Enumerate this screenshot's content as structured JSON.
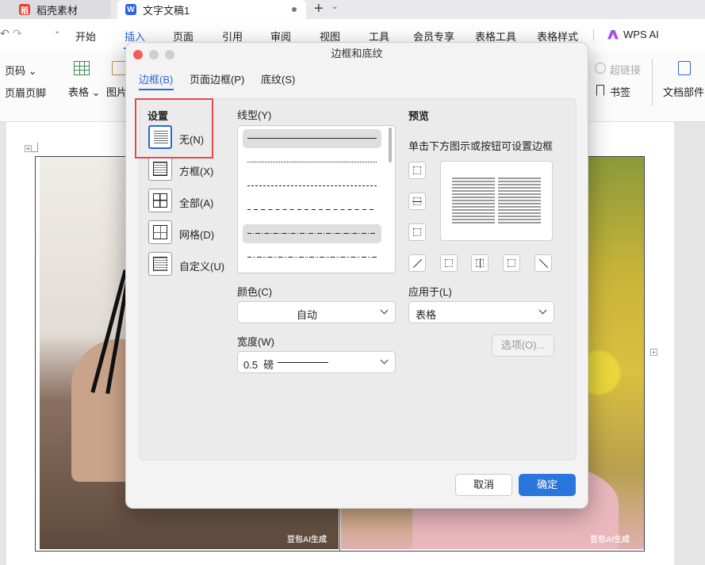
{
  "tabs": {
    "app_tab": "稻壳素材",
    "doc_tab": "文字文稿1"
  },
  "menu": {
    "items": [
      "开始",
      "插入",
      "页面",
      "引用",
      "审阅",
      "视图",
      "工具",
      "会员专享",
      "表格工具",
      "表格样式"
    ],
    "active": "插入",
    "ai_label": "WPS AI"
  },
  "toolbar": {
    "page_number": "页码",
    "header_footer": "页眉页脚",
    "table": "表格",
    "picture": "图片",
    "hyperlink": "超链接",
    "bookmark": "书签",
    "doc_parts": "文档部件"
  },
  "document": {
    "watermark": "豆包AI生成"
  },
  "dialog": {
    "title": "边框和底纹",
    "tabs": [
      "边框(B)",
      "页面边框(P)",
      "底纹(S)"
    ],
    "active_tab": "边框(B)",
    "settings_label": "设置",
    "settings": [
      {
        "label": "无(N)",
        "selected": true
      },
      {
        "label": "方框(X)",
        "selected": false
      },
      {
        "label": "全部(A)",
        "selected": false
      },
      {
        "label": "网格(D)",
        "selected": false
      },
      {
        "label": "自定义(U)",
        "selected": false
      }
    ],
    "line_style_label": "线型(Y)",
    "line_styles": [
      "solid",
      "dotted",
      "dashed-fine",
      "dashed",
      "dash-dot",
      "dash-dot-dot"
    ],
    "selected_line_style": "solid",
    "color_label": "颜色(C)",
    "color_value": "自动",
    "width_label": "宽度(W)",
    "width_value": "0.5  磅",
    "preview_label": "预览",
    "preview_hint": "单击下方图示或按钮可设置边框",
    "apply_to_label": "应用于(L)",
    "apply_to_value": "表格",
    "options_button": "选项(O)...",
    "cancel_button": "取消",
    "ok_button": "确定"
  },
  "colors": {
    "accent": "#2a6ad8",
    "primary_button": "#2a76dd",
    "highlight_box": "#e74a4a"
  }
}
